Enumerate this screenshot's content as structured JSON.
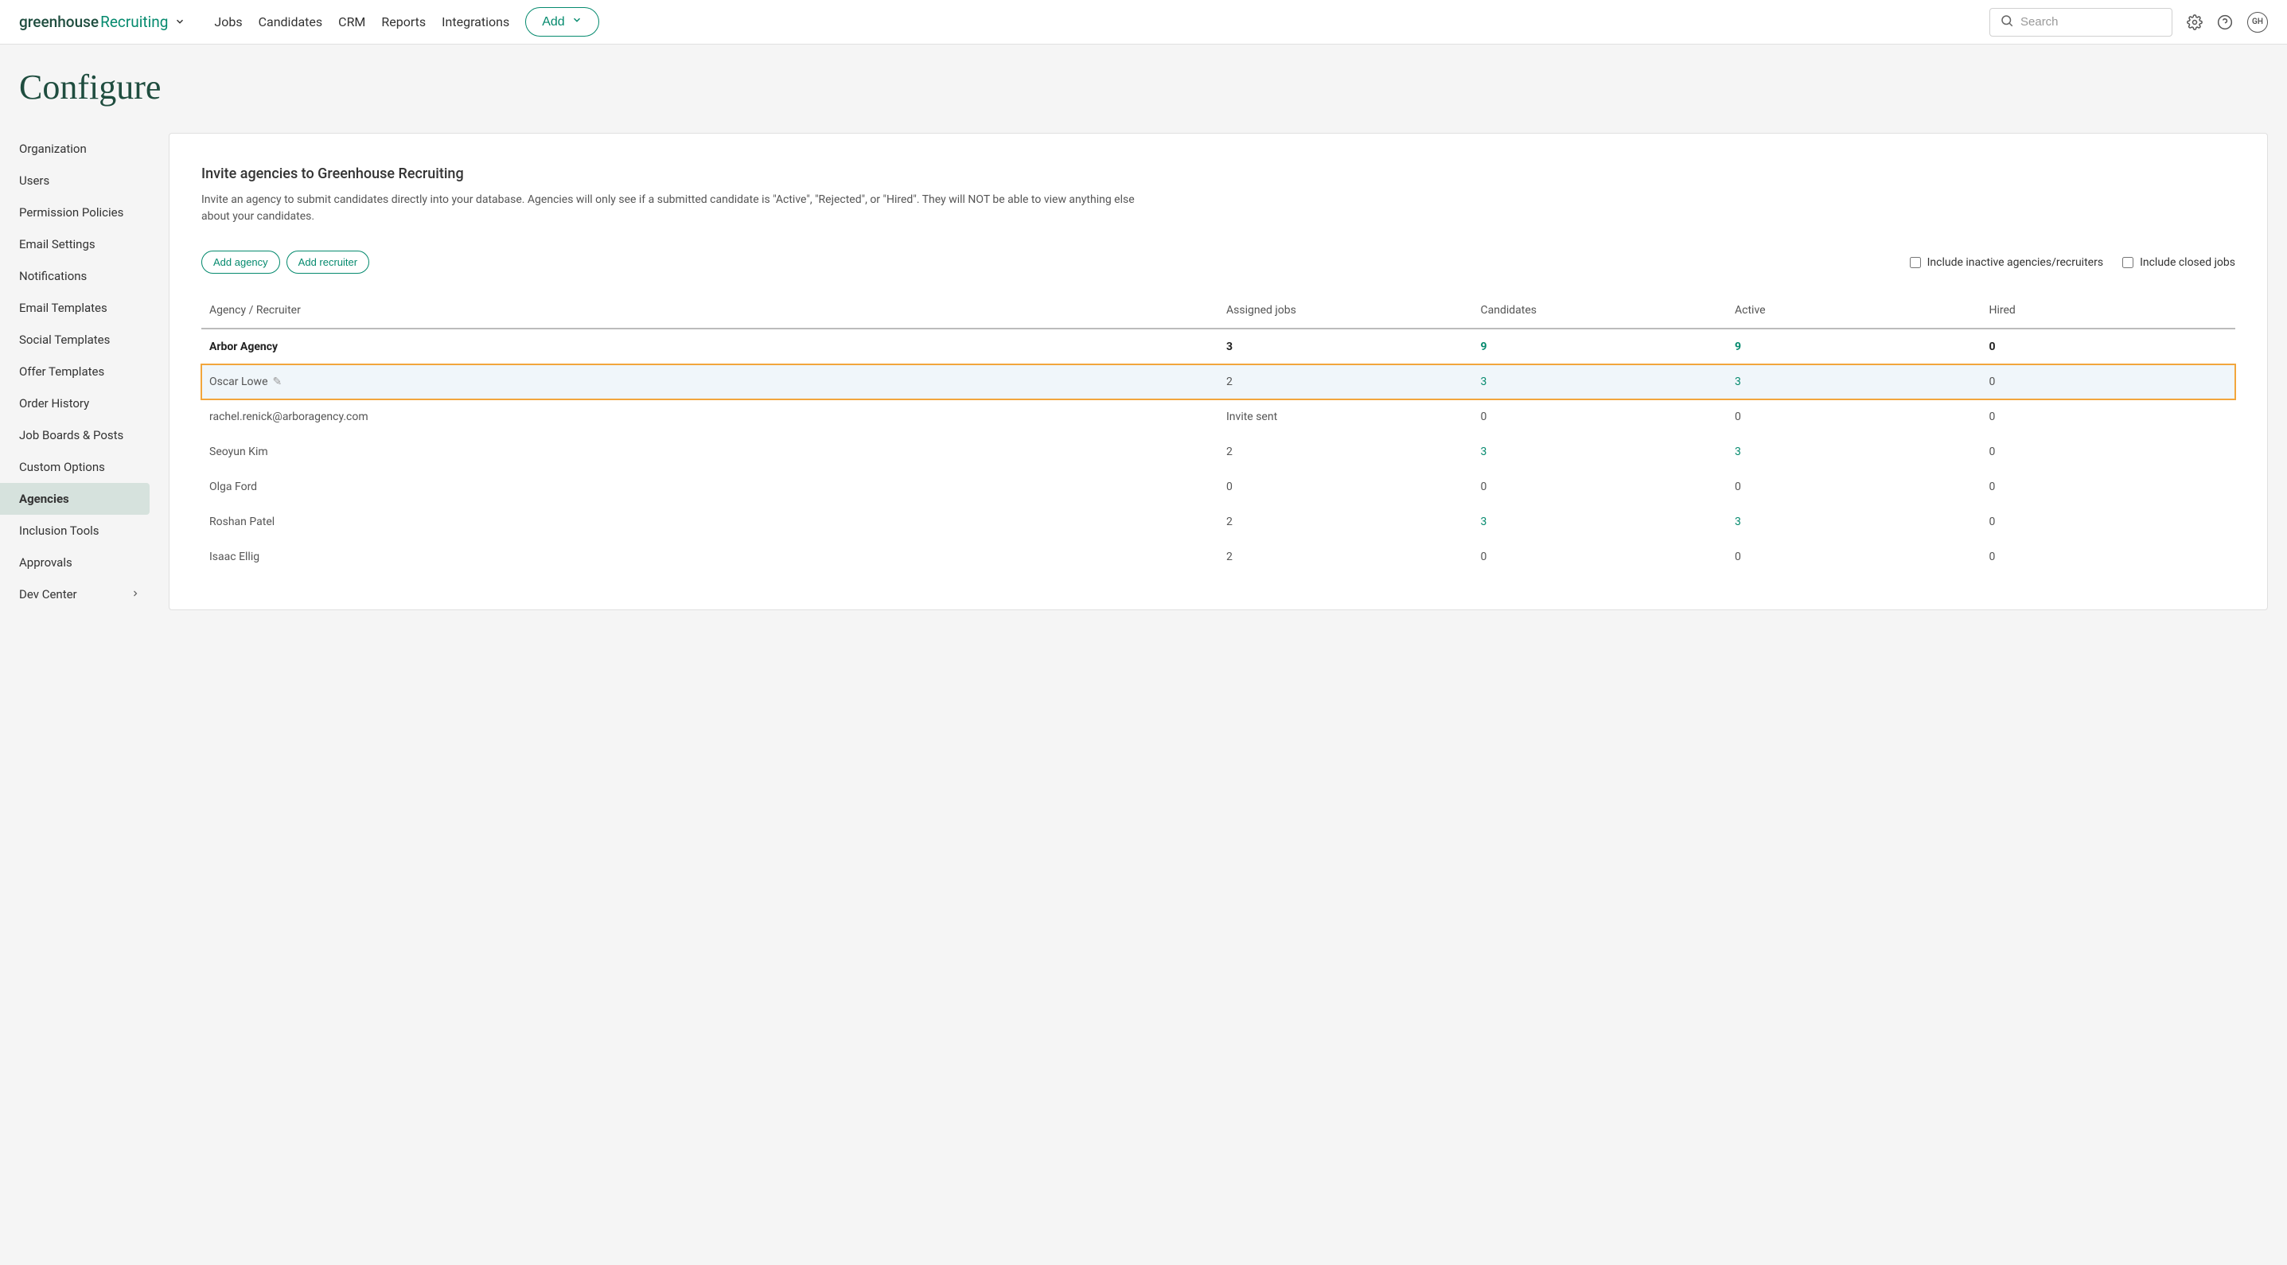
{
  "header": {
    "brand_main": "greenhouse",
    "brand_sub": "Recruiting",
    "nav": [
      "Jobs",
      "Candidates",
      "CRM",
      "Reports",
      "Integrations"
    ],
    "add_label": "Add",
    "search_placeholder": "Search",
    "avatar": "GH"
  },
  "page": {
    "title": "Configure"
  },
  "sidebar": {
    "items": [
      {
        "label": "Organization"
      },
      {
        "label": "Users"
      },
      {
        "label": "Permission Policies"
      },
      {
        "label": "Email Settings"
      },
      {
        "label": "Notifications"
      },
      {
        "label": "Email Templates"
      },
      {
        "label": "Social Templates"
      },
      {
        "label": "Offer Templates"
      },
      {
        "label": "Order History"
      },
      {
        "label": "Job Boards & Posts"
      },
      {
        "label": "Custom Options"
      },
      {
        "label": "Agencies",
        "active": true
      },
      {
        "label": "Inclusion Tools"
      },
      {
        "label": "Approvals"
      },
      {
        "label": "Dev Center",
        "chevron": true
      }
    ]
  },
  "panel": {
    "heading": "Invite agencies to Greenhouse Recruiting",
    "description": "Invite an agency to submit candidates directly into your database. Agencies will only see if a submitted candidate is \"Active\", \"Rejected\", or \"Hired\". They will NOT be able to view anything else about your candidates.",
    "add_agency_label": "Add agency",
    "add_recruiter_label": "Add recruiter",
    "include_inactive_label": "Include inactive agencies/recruiters",
    "include_closed_label": "Include closed jobs",
    "columns": [
      "Agency / Recruiter",
      "Assigned jobs",
      "Candidates",
      "Active",
      "Hired"
    ],
    "rows": [
      {
        "type": "agency",
        "name": "Arbor Agency",
        "assigned": "3",
        "candidates": "9",
        "candidates_link": true,
        "active": "9",
        "active_link": true,
        "hired": "0"
      },
      {
        "type": "recruiter",
        "name": "Oscar Lowe",
        "edit": true,
        "highlighted": true,
        "assigned": "2",
        "candidates": "3",
        "candidates_link": true,
        "active": "3",
        "active_link": true,
        "hired": "0"
      },
      {
        "type": "recruiter",
        "name": "rachel.renick@arboragency.com",
        "assigned": "Invite sent",
        "candidates": "0",
        "active": "0",
        "hired": "0"
      },
      {
        "type": "recruiter",
        "name": "Seoyun Kim",
        "assigned": "2",
        "candidates": "3",
        "candidates_link": true,
        "active": "3",
        "active_link": true,
        "hired": "0"
      },
      {
        "type": "recruiter",
        "name": "Olga Ford",
        "assigned": "0",
        "candidates": "0",
        "active": "0",
        "hired": "0"
      },
      {
        "type": "recruiter",
        "name": "Roshan Patel",
        "assigned": "2",
        "candidates": "3",
        "candidates_link": true,
        "active": "3",
        "active_link": true,
        "hired": "0"
      },
      {
        "type": "recruiter",
        "name": "Isaac Ellig",
        "assigned": "2",
        "candidates": "0",
        "active": "0",
        "hired": "0"
      }
    ]
  }
}
